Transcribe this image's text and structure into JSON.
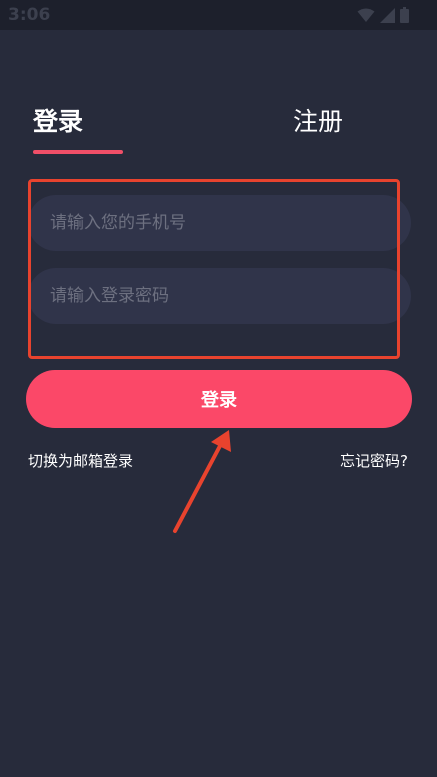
{
  "status_bar": {
    "time": "3:06",
    "icons": [
      "wifi-icon",
      "signal-icon",
      "battery-icon"
    ]
  },
  "tabs": {
    "login": "登录",
    "register": "注册",
    "active": "login"
  },
  "form": {
    "phone_placeholder": "请输入您的手机号",
    "password_placeholder": "请输入登录密码",
    "phone_value": "",
    "password_value": ""
  },
  "login_button_label": "登录",
  "links": {
    "switch_email": "切换为邮箱登录",
    "forgot_password": "忘记密码?"
  },
  "colors": {
    "background": "#272b3b",
    "input_background": "#30344a",
    "accent": "#fb4868",
    "tab_indicator": "#f04f68",
    "annotation": "#e8432e"
  }
}
